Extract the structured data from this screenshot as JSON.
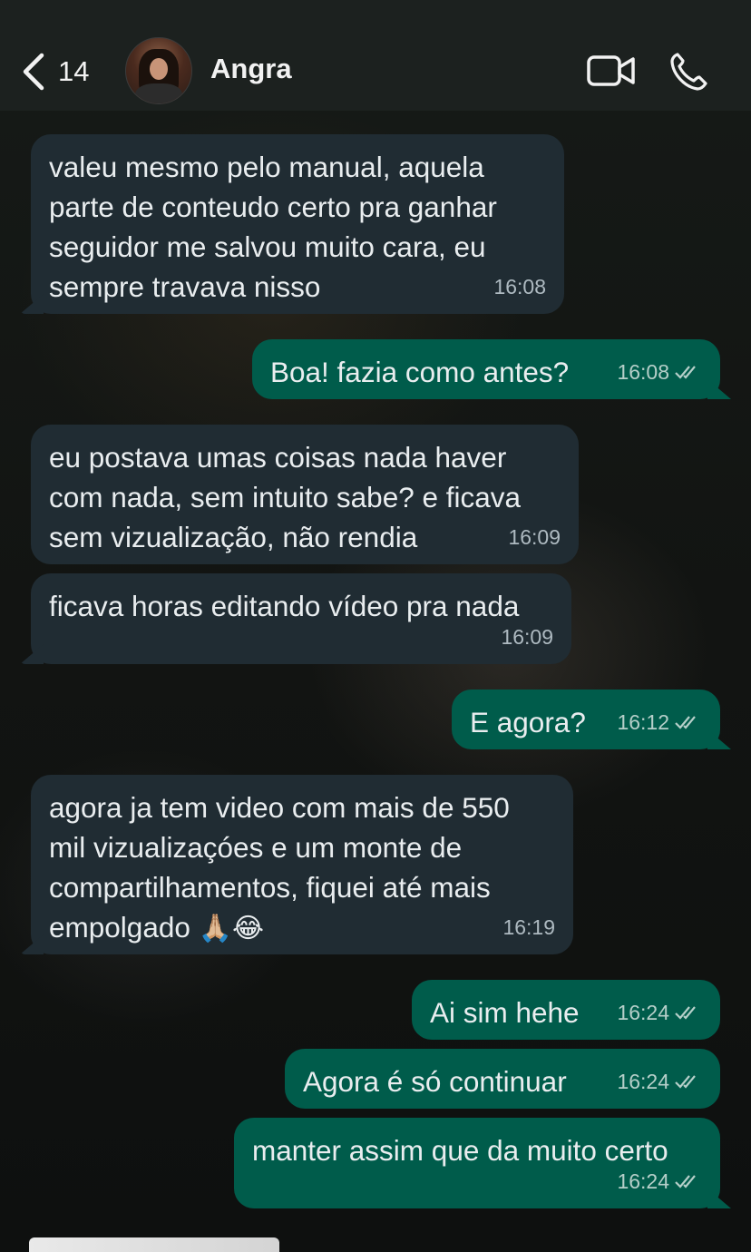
{
  "header": {
    "back_count": "14",
    "contact_name": "Angra",
    "icons": {
      "back": "chevron-left-icon",
      "video": "video-camera-icon",
      "call": "phone-icon"
    }
  },
  "colors": {
    "incoming_bubble": "#202c33",
    "outgoing_bubble": "#005c4b",
    "header_bg": "#1c211f",
    "read_ticks": "#b5cfc9"
  },
  "messages": [
    {
      "direction": "in",
      "text": "valeu mesmo pelo manual, aquela\nparte de conteudo certo pra ganhar\nseguidor me salvou muito cara, eu\nsempre travava nisso",
      "time": "16:08"
    },
    {
      "direction": "out",
      "text": "Boa! fazia como antes?",
      "time": "16:08",
      "status": "read"
    },
    {
      "direction": "in",
      "text": "eu postava umas coisas nada haver\ncom nada, sem intuito sabe? e ficava\nsem vizualização, não rendia",
      "time": "16:09"
    },
    {
      "direction": "in",
      "text": "ficava horas editando vídeo pra nada",
      "time": "16:09"
    },
    {
      "direction": "out",
      "text": "E agora?",
      "time": "16:12",
      "status": "read"
    },
    {
      "direction": "in",
      "text": "agora ja tem video com mais de 550\nmil vizualizaçóes e um monte de\ncompartilhamentos, fiquei até mais\nempolgado",
      "emojis": "🙏🏼😂",
      "time": "16:19"
    },
    {
      "direction": "out",
      "text": "Ai sim hehe",
      "time": "16:24",
      "status": "read"
    },
    {
      "direction": "out",
      "text": "Agora é só continuar",
      "time": "16:24",
      "status": "read"
    },
    {
      "direction": "out",
      "text": "manter assim que da muito certo",
      "time": "16:24",
      "status": "read"
    }
  ]
}
